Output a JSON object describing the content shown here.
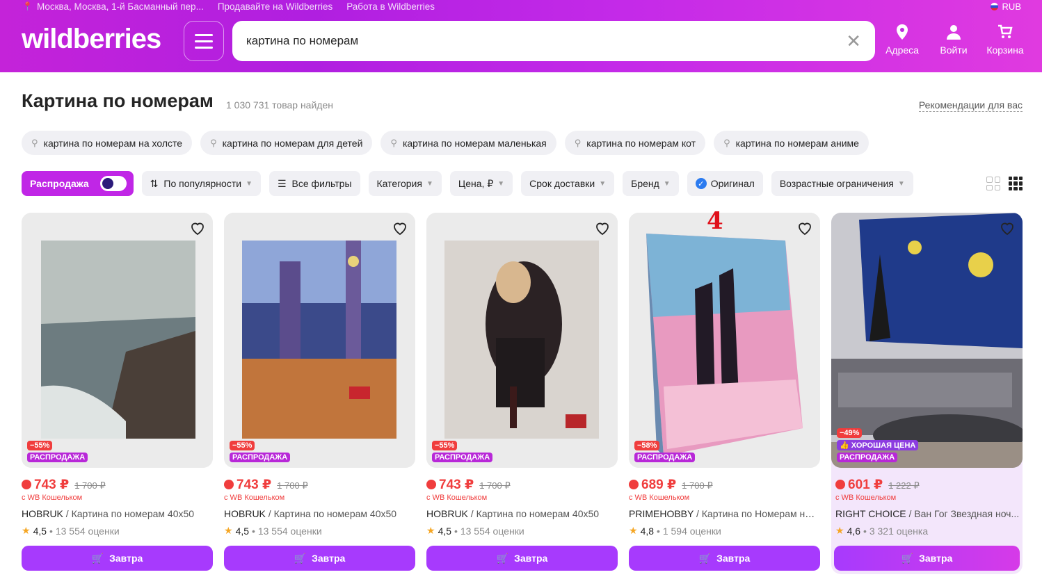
{
  "header": {
    "location": "Москва, Москва, 1-й Басманный пер...",
    "links": [
      "Продавайте на Wildberries",
      "Работа в Wildberries"
    ],
    "currency": "RUB",
    "logo": "wildberries",
    "search_value": "картина по номерам",
    "icons": [
      {
        "label": "Адреса",
        "icon": "pin-icon"
      },
      {
        "label": "Войти",
        "icon": "user-icon"
      },
      {
        "label": "Корзина",
        "icon": "cart-icon"
      }
    ]
  },
  "page": {
    "title": "Картина по номерам",
    "count": "1 030 731 товар найден",
    "recommendations": "Рекомендации для вас"
  },
  "chips": [
    "картина по номерам на холсте",
    "картина по номерам для детей",
    "картина по номерам маленькая",
    "картина по номерам кот",
    "картина по номерам аниме"
  ],
  "filters": {
    "sale": "Распродажа",
    "sort": "По популярности",
    "all": "Все фильтры",
    "items": [
      "Категория",
      "Цена, ₽",
      "Срок доставки",
      "Бренд"
    ],
    "original": "Оригинал",
    "age": "Возрастные ограничения"
  },
  "annotation": "4",
  "products": [
    {
      "discount": "−55%",
      "label": "РАСПРОДАЖА",
      "price": "743 ₽",
      "old": "1 700 ₽",
      "wallet": "с WB Кошельком",
      "brand": "HOBRUK",
      "title": " / Картина по номерам 40х50",
      "rating": "4,5",
      "reviews": "• 13 554 оценки",
      "button": "Завтра"
    },
    {
      "discount": "−55%",
      "label": "РАСПРОДАЖА",
      "price": "743 ₽",
      "old": "1 700 ₽",
      "wallet": "с WB Кошельком",
      "brand": "HOBRUK",
      "title": " / Картина по номерам 40х50",
      "rating": "4,5",
      "reviews": "• 13 554 оценки",
      "button": "Завтра"
    },
    {
      "discount": "−55%",
      "label": "РАСПРОДАЖА",
      "price": "743 ₽",
      "old": "1 700 ₽",
      "wallet": "с WB Кошельком",
      "brand": "HOBRUK",
      "title": " / Картина по номерам 40х50",
      "rating": "4,5",
      "reviews": "• 13 554 оценки",
      "button": "Завтра"
    },
    {
      "discount": "−58%",
      "label": "РАСПРОДАЖА",
      "price": "689 ₽",
      "old": "1 700 ₽",
      "wallet": "с WB Кошельком",
      "brand": "PRIMEHOBBY",
      "title": " / Картина по Номерам на ...",
      "rating": "4,8",
      "reviews": "• 1 594 оценки",
      "button": "Завтра"
    },
    {
      "discount": "−49%",
      "good": "ХОРОШАЯ ЦЕНА",
      "label": "РАСПРОДАЖА",
      "price": "601 ₽",
      "old": "1 222 ₽",
      "wallet": "с WB Кошельком",
      "brand": "RIGHT CHOICE",
      "title": " / Ван Гог Звездная ноч...",
      "rating": "4,6",
      "reviews": "• 3 321 оценка",
      "button": "Завтра"
    }
  ]
}
